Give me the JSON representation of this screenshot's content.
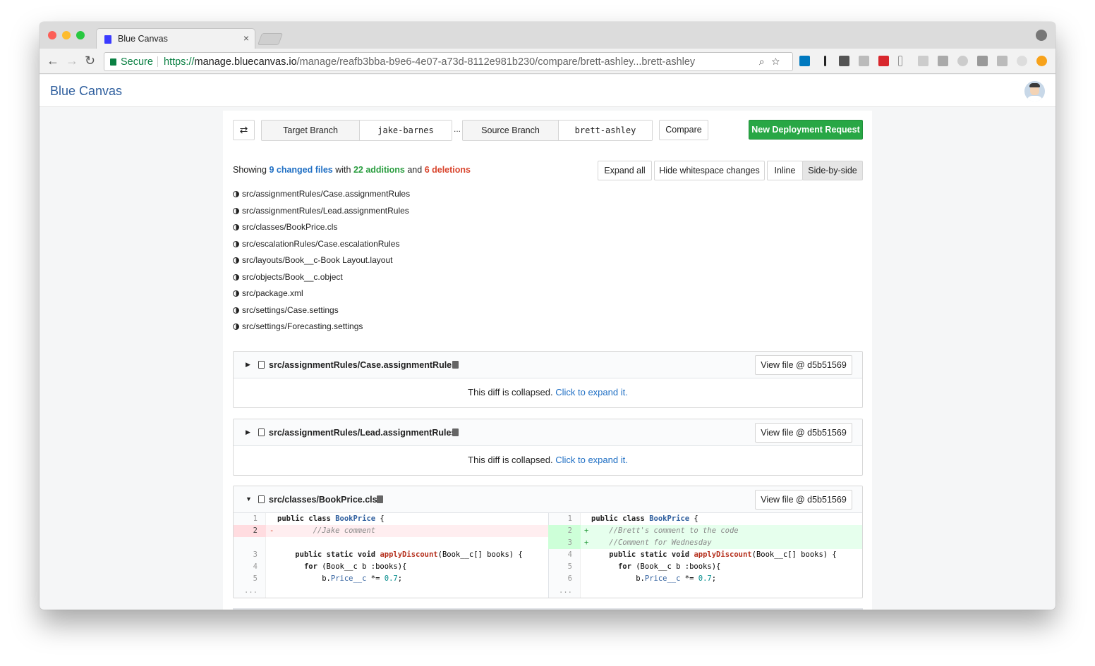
{
  "browser": {
    "tab_title": "Blue Canvas",
    "tab_close": "×",
    "secure_label": "Secure",
    "url_protocol": "https://",
    "url_host": "manage.bluecanvas.io",
    "url_path": "/manage/reafb3bba-b9e6-4e07-a73d-8112e981b230/compare/brett-ashley...brett-ashley",
    "back": "←",
    "forward": "→",
    "reload": "↻",
    "omni_icons": "⌕☆"
  },
  "app": {
    "brand": "Blue Canvas"
  },
  "compare": {
    "swap_icon": "⇄",
    "target_label": "Target Branch",
    "target_value": "jake-barnes",
    "separator": "...",
    "source_label": "Source Branch",
    "source_value": "brett-ashley",
    "compare_button": "Compare",
    "new_request_button": "New Deployment Request"
  },
  "summary": {
    "showing": "Showing ",
    "changed_files": "9 changed files",
    "with": " with ",
    "additions": "22 additions",
    "and": " and ",
    "deletions": "6 deletions",
    "expand_all": "Expand all",
    "hide_whitespace": "Hide whitespace changes",
    "inline": "Inline",
    "side_by_side": "Side-by-side"
  },
  "files": [
    "src/assignmentRules/Case.assignmentRules",
    "src/assignmentRules/Lead.assignmentRules",
    "src/classes/BookPrice.cls",
    "src/escalationRules/Case.escalationRules",
    "src/layouts/Book__c-Book Layout.layout",
    "src/objects/Book__c.object",
    "src/package.xml",
    "src/settings/Case.settings",
    "src/settings/Forecasting.settings"
  ],
  "diffs": [
    {
      "file": "src/assignmentRules/Case.assignmentRules",
      "view_file": "View file @ d5b51569",
      "collapsed_text": "This diff is collapsed. ",
      "expand_link": "Click to expand it."
    },
    {
      "file": "src/assignmentRules/Lead.assignmentRules",
      "view_file": "View file @ d5b51569",
      "collapsed_text": "This diff is collapsed. ",
      "expand_link": "Click to expand it."
    },
    {
      "file": "src/classes/BookPrice.cls",
      "view_file": "View file @ d5b51569",
      "left": {
        "ln": [
          "1",
          "2",
          "",
          "3",
          "4",
          "5",
          "..."
        ],
        "signs": [
          "",
          "-",
          "",
          "",
          "",
          "",
          ""
        ]
      },
      "right": {
        "ln": [
          "1",
          "2",
          "3",
          "4",
          "5",
          "6",
          "..."
        ],
        "signs": [
          "",
          "+",
          "+",
          "",
          "",
          "",
          ""
        ]
      },
      "text": {
        "public": "public",
        "class": "class",
        "static": "static",
        "void": "void",
        "for": "for",
        "class_name": "BookPrice",
        "brace_open": " {",
        "method": "applyDiscount",
        "params": "(Book__c[] books) {",
        "for_body": " (Book__c b :books){",
        "b_dot": "b.",
        "price_field": "Price__c",
        "op": " *= ",
        "discount": "0.7",
        "semi": ";",
        "jake_comment": "//Jake comment",
        "brett_comment": "//Brett's comment to the code",
        "wednesday_comment": "//Comment for Wednesday"
      }
    }
  ],
  "colors": {
    "brand": "#2f5f9e",
    "green_button": "#28a745",
    "addition": "#2a9d3f",
    "deletion": "#d9452d",
    "link": "#1f6fc4",
    "added_row": "#e6ffed",
    "added_gutter": "#cdffd8",
    "deleted_row": "#ffeef0",
    "deleted_gutter": "#ffdce0"
  }
}
